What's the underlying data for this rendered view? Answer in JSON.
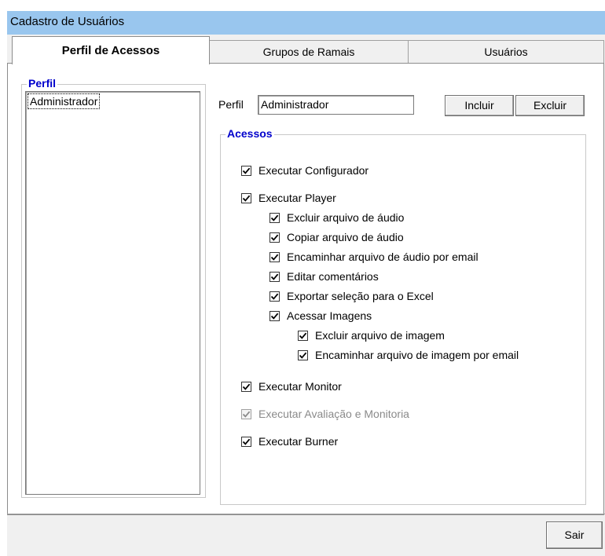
{
  "window": {
    "title": "Cadastro de Usuários"
  },
  "tabs": [
    {
      "label": "Perfil de Acessos",
      "active": true
    },
    {
      "label": "Grupos de Ramais",
      "active": false
    },
    {
      "label": "Usuários",
      "active": false
    }
  ],
  "perfil_group": {
    "legend": "Perfil",
    "items": [
      "Administrador"
    ],
    "selected": "Administrador"
  },
  "perfil_field": {
    "label": "Perfil",
    "value": "Administrador"
  },
  "buttons": {
    "incluir": "Incluir",
    "excluir": "Excluir",
    "sair": "Sair"
  },
  "acessos": {
    "legend": "Acessos",
    "options": [
      {
        "label": "Executar Configurador",
        "checked": true,
        "enabled": true
      },
      {
        "label": "Executar Player",
        "checked": true,
        "enabled": true
      },
      {
        "label": "Excluir arquivo de áudio",
        "checked": true,
        "enabled": true
      },
      {
        "label": "Copiar arquivo de áudio",
        "checked": true,
        "enabled": true
      },
      {
        "label": "Encaminhar arquivo de áudio por email",
        "checked": true,
        "enabled": true
      },
      {
        "label": "Editar comentários",
        "checked": true,
        "enabled": true
      },
      {
        "label": "Exportar seleção para o Excel",
        "checked": true,
        "enabled": true
      },
      {
        "label": "Acessar Imagens",
        "checked": true,
        "enabled": true
      },
      {
        "label": "Excluir arquivo de imagem",
        "checked": true,
        "enabled": true
      },
      {
        "label": "Encaminhar arquivo de imagem por email",
        "checked": true,
        "enabled": true
      },
      {
        "label": "Executar Monitor",
        "checked": true,
        "enabled": true
      },
      {
        "label": "Executar Avaliação e Monitoria",
        "checked": true,
        "enabled": false
      },
      {
        "label": "Executar Burner",
        "checked": true,
        "enabled": true
      }
    ]
  },
  "icons": {
    "check": "checkmark-icon"
  }
}
